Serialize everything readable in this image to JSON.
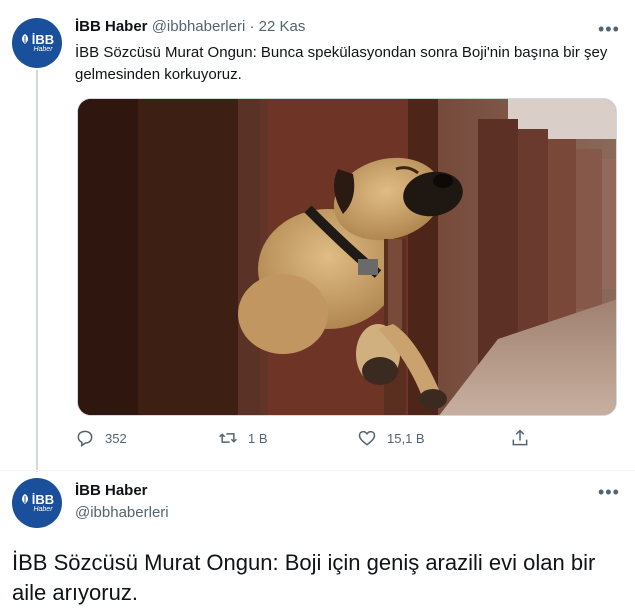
{
  "tweet1": {
    "avatar_text": "İBB",
    "avatar_sub": "Haber",
    "display_name": "İBB Haber",
    "handle": "@ibbhaberleri",
    "separator": "·",
    "time": "22 Kas",
    "more_icon": "more-dots-icon",
    "text": "İBB Sözcüsü Murat Ongun: Bunca spekülasyondan sonra Boji'nin başına bir şey gelmesinden korkuyoruz.",
    "image": "photo-sleeping-dog",
    "actions": {
      "reply_count": "352",
      "retweet_count": "1 B",
      "like_count": "15,1 B"
    }
  },
  "tweet2": {
    "avatar_text": "İBB",
    "avatar_sub": "Haber",
    "display_name": "İBB Haber",
    "handle": "@ibbhaberleri",
    "more_icon": "more-dots-icon",
    "text": "İBB Sözcüsü Murat Ongun: Boji için geniş arazili evi olan bir aile arıyoruz."
  },
  "colors": {
    "avatar_bg": "#1a4f9c",
    "text": "#0f1419",
    "secondary": "#536471",
    "border": "#cfd9de"
  }
}
